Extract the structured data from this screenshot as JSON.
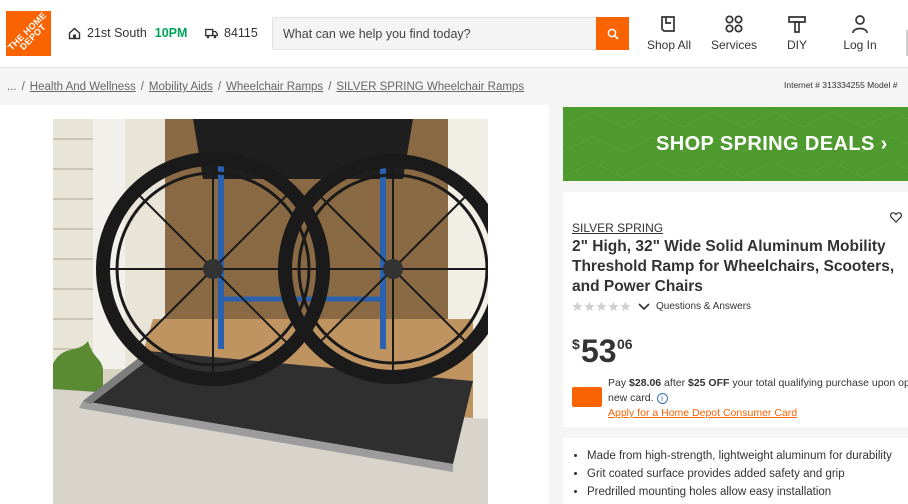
{
  "header": {
    "logo_text": "THE HOME DEPOT",
    "store_name": "21st South",
    "store_hours": "10PM",
    "zip": "84115",
    "search_placeholder": "What can we help you find today?",
    "nav": [
      {
        "label": "Shop All",
        "icon": "shop-all-icon"
      },
      {
        "label": "Services",
        "icon": "services-icon"
      },
      {
        "label": "DIY",
        "icon": "diy-icon"
      },
      {
        "label": "Log In",
        "icon": "user-icon"
      }
    ]
  },
  "breadcrumb": {
    "lead": "...",
    "items": [
      "Health And Wellness",
      "Mobility Aids",
      "Wheelchair Ramps",
      "SILVER SPRING Wheelchair Ramps"
    ]
  },
  "model_info": "Internet # 313334255  Model #",
  "promo": {
    "text": "SHOP SPRING DEALS",
    "chevron": "›"
  },
  "product": {
    "brand": "SILVER SPRING",
    "title": "2\" High, 32\" Wide Solid Aluminum Mobility Threshold Ramp for Wheelchairs, Scooters, and Power Chairs",
    "qa_label": "Questions & Answers",
    "rating": 0,
    "price_currency": "$",
    "price_dollars": "53",
    "price_cents": "06",
    "pay_prefix": "Pay ",
    "pay_amount": "$28.06",
    "pay_mid": " after ",
    "pay_off": "$25 OFF",
    "pay_suffix": " your total qualifying purchase upon ope",
    "pay_line2": "new card.",
    "apply_link": "Apply for a Home Depot Consumer Card"
  },
  "bullets": [
    "Made from high-strength, lightweight aluminum for durability",
    "Grit coated surface provides added safety and grip",
    "Predrilled mounting holes allow easy installation"
  ],
  "colors": {
    "brand_orange": "#f96302",
    "promo_green": "#4e9a2f",
    "hours_green": "#00a359"
  }
}
